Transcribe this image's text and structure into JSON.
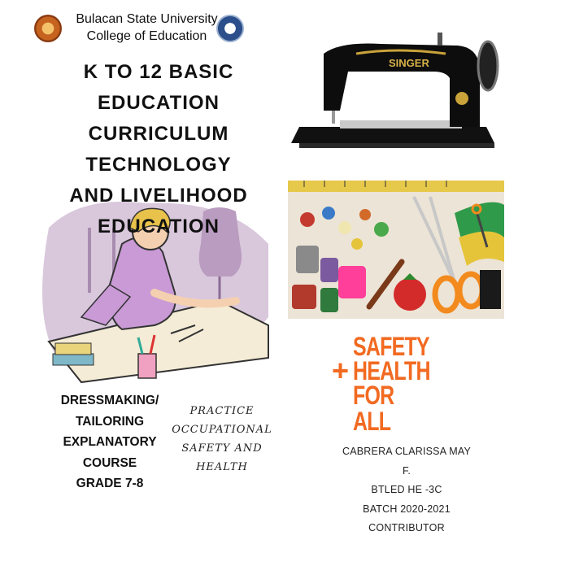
{
  "header": {
    "university": "Bulacan State University",
    "college": "College of Education"
  },
  "title_lines": [
    "K TO 12 BASIC",
    "EDUCATION",
    "CURRICULUM",
    "TECHNOLOGY",
    "AND LIVELIHOOD",
    "EDUCATION"
  ],
  "course_lines": [
    "DRESSMAKING/",
    "TAILORING",
    "EXPLANATORY",
    "COURSE",
    "GRADE 7-8"
  ],
  "practice_lines": [
    "PRACTICE",
    "OCCUPATIONAL",
    "SAFETY AND",
    "HEALTH"
  ],
  "machine_brand": "SINGER",
  "safety_logo": {
    "line1": "SAFETY",
    "plus": "+",
    "line2": "HEALTH",
    "line3": "FOR ALL",
    "color": "#f26a21"
  },
  "contributor_lines": [
    "CABRERA CLARISSA MAY",
    "F.",
    "BTLED HE -3C",
    "BATCH 2020-2021",
    "CONTRIBUTOR"
  ]
}
